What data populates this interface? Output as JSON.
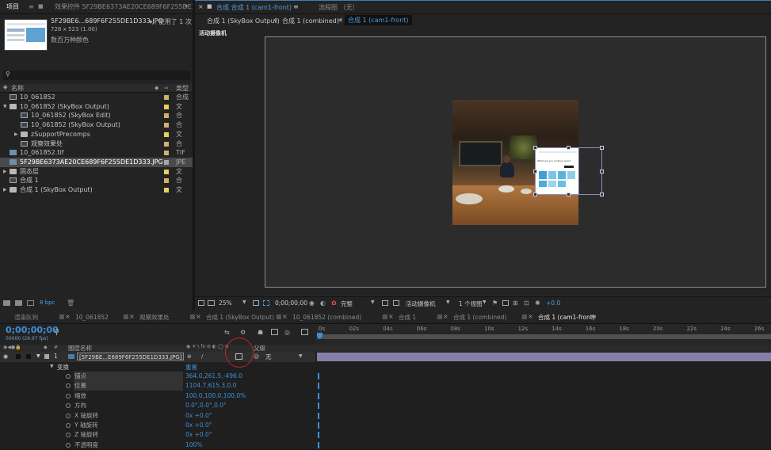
{
  "project_panel": {
    "tabs": [
      "项目",
      "效果控件 5F29BE6373AE20CE689F6F255DE1D3"
    ],
    "preview": {
      "filename": "5F29BE6...689F6F255DE1D333.JPG",
      "used_text": "▾ , 使用了 1 次",
      "dimensions": "728 x 523 (1.00)",
      "colors": "数百万种颜色"
    },
    "search_placeholder": "",
    "col_name": "名称",
    "col_type": "类型",
    "items": [
      {
        "name": "10_061852",
        "type": "合成",
        "color": "#d1b16a",
        "icon": "composition-icon",
        "indent": 0,
        "arrow": ""
      },
      {
        "name": "10_061852 (SkyBox Output)",
        "type": "文",
        "color": "#e8d25a",
        "icon": "folder-icon",
        "indent": 0,
        "arrow": "▼"
      },
      {
        "name": "10_061852 (SkyBox Edit)",
        "type": "合",
        "color": "#d1b16a",
        "icon": "composition-icon",
        "indent": 1,
        "arrow": ""
      },
      {
        "name": "10_061852 (SkyBox Output)",
        "type": "合",
        "color": "#d1b16a",
        "icon": "composition-icon",
        "indent": 1,
        "arrow": ""
      },
      {
        "name": "zSupportPrecomps",
        "type": "文",
        "color": "#e8d25a",
        "icon": "folder-icon",
        "indent": 1,
        "arrow": "▶"
      },
      {
        "name": "观察效果处",
        "type": "合",
        "color": "#d1b16a",
        "icon": "composition-icon",
        "indent": 1,
        "arrow": ""
      },
      {
        "name": "10_061852.tif",
        "type": "TIF",
        "color": "#d1b16a",
        "icon": "image-file-icon",
        "indent": 0,
        "arrow": ""
      },
      {
        "name": "5F29BE6373AE20CE689F6F255DE1D333.JPG",
        "type": "JPE",
        "color": "#a7a7a7",
        "icon": "image-file-icon",
        "indent": 0,
        "arrow": "",
        "selected": true
      },
      {
        "name": "固态层",
        "type": "文",
        "color": "#e8d25a",
        "icon": "folder-icon",
        "indent": 0,
        "arrow": "▶"
      },
      {
        "name": "合成 1",
        "type": "合",
        "color": "#d1b16a",
        "icon": "composition-icon",
        "indent": 0,
        "arrow": ""
      },
      {
        "name": "合成 1 (SkyBox Output)",
        "type": "文",
        "color": "#e8d25a",
        "icon": "folder-icon",
        "indent": 0,
        "arrow": "▶"
      }
    ],
    "bottom_bpc": "8 bpc"
  },
  "comp_viewer": {
    "tabs": [
      "合成 合成 1 (cam1-front)",
      "流程图 （无）"
    ],
    "breadcrumbs": [
      "合成 1 (SkyBox Output)",
      "合成 1 (combined)",
      "合成 1 (cam1-front)"
    ],
    "camera_label": "活动摄像机",
    "photo_panel_title": "What are you looking up to?",
    "zoom": "25%",
    "timecode": "0;00;00;00",
    "quality": "完整",
    "camera": "活动摄像机",
    "views": "1 个视图",
    "exposure": "+0.0"
  },
  "timeline": {
    "tabs": [
      "渲染队列",
      "10_061852",
      "观察效果处",
      "合成 1 (SkyBox Output)",
      "10_061852 (combined)",
      "合成 1",
      "合成 1 (combined)",
      "合成 1 (cam1-front)"
    ],
    "active_tab": "合成 1 (cam1-front)",
    "timecode": "0;00;00;00",
    "fps": "00000 (29.97 fps)",
    "ticks": [
      "0s",
      "02s",
      "04s",
      "06s",
      "08s",
      "10s",
      "12s",
      "14s",
      "16s",
      "18s",
      "20s",
      "22s",
      "24s",
      "26s"
    ],
    "col_layer_name": "图层名称",
    "col_parent": "父级",
    "layer": {
      "index": "1",
      "name": "[5F29BE...E689F6F255DE1D333.JPG]",
      "parent": "无"
    },
    "transform_label": "变换",
    "reset_label": "重置",
    "properties": [
      {
        "name": "锚点",
        "value": "364.0,261.5,-496.0"
      },
      {
        "name": "位置",
        "value": "1104.7,615.3,0.0"
      },
      {
        "name": "缩放",
        "value": "100.0,100.0,100.0%"
      },
      {
        "name": "方向",
        "value": "0.0°,0.0°,0.0°"
      },
      {
        "name": "X 轴旋转",
        "value": "0x +0.0°"
      },
      {
        "name": "Y 轴旋转",
        "value": "0x +0.0°"
      },
      {
        "name": "Z 轴旋转",
        "value": "0x +0.0°"
      },
      {
        "name": "不透明度",
        "value": "100%"
      }
    ]
  }
}
